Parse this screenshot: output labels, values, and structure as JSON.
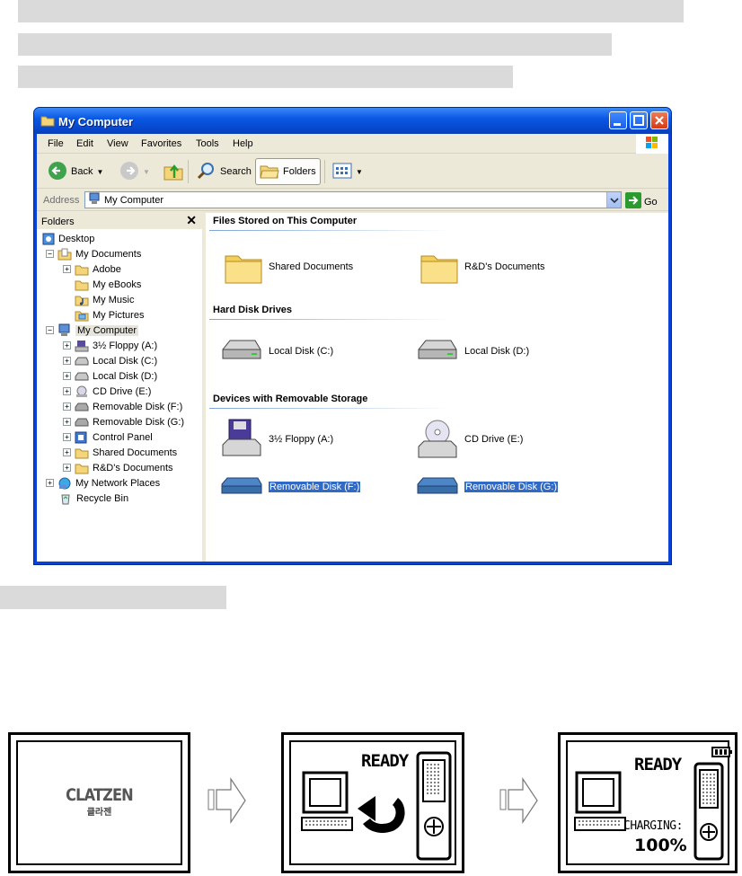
{
  "window": {
    "title": "My Computer",
    "menu": [
      "File",
      "Edit",
      "View",
      "Favorites",
      "Tools",
      "Help"
    ],
    "toolbar": {
      "back": "Back",
      "search": "Search",
      "folders": "Folders"
    },
    "address": {
      "label": "Address",
      "value": "My Computer",
      "go": "Go"
    }
  },
  "folders_pane": {
    "title": "Folders",
    "close": "✕",
    "tree": [
      {
        "label": "Desktop",
        "icon": "desktop-icon"
      },
      {
        "label": "My Documents",
        "icon": "my-documents-icon"
      },
      {
        "label": "Adobe",
        "icon": "folder-icon"
      },
      {
        "label": "My eBooks",
        "icon": "folder-icon"
      },
      {
        "label": "My Music",
        "icon": "music-folder-icon"
      },
      {
        "label": "My Pictures",
        "icon": "pictures-folder-icon"
      },
      {
        "label": "My Computer",
        "icon": "computer-icon"
      },
      {
        "label": "3½ Floppy (A:)",
        "icon": "floppy-icon"
      },
      {
        "label": "Local Disk (C:)",
        "icon": "disk-icon"
      },
      {
        "label": "Local Disk (D:)",
        "icon": "disk-icon"
      },
      {
        "label": "CD Drive (E:)",
        "icon": "cd-icon"
      },
      {
        "label": "Removable Disk (F:)",
        "icon": "removable-disk-icon"
      },
      {
        "label": "Removable Disk (G:)",
        "icon": "removable-disk-icon"
      },
      {
        "label": "Control Panel",
        "icon": "control-panel-icon"
      },
      {
        "label": "Shared Documents",
        "icon": "folder-icon"
      },
      {
        "label": "R&D's Documents",
        "icon": "folder-icon"
      },
      {
        "label": "My Network Places",
        "icon": "network-icon"
      },
      {
        "label": "Recycle Bin",
        "icon": "recycle-bin-icon"
      }
    ]
  },
  "content": {
    "groups": [
      {
        "title": "Files Stored on This Computer",
        "items": [
          "Shared Documents",
          "R&D's Documents"
        ]
      },
      {
        "title": "Hard Disk Drives",
        "items": [
          "Local Disk (C:)",
          "Local Disk (D:)"
        ]
      },
      {
        "title": "Devices with Removable Storage",
        "items": [
          "3½ Floppy (A:)",
          "CD Drive (E:)",
          "Removable Disk (F:)",
          "Removable Disk (G:)"
        ]
      }
    ]
  },
  "device_screens": {
    "screen1": {
      "logo": "CLATZEN",
      "logo_sub": "클라젠"
    },
    "screen2": {
      "status": "READY"
    },
    "screen3": {
      "status": "READY",
      "charging_label": "CHARGING:",
      "charging_value": "100%"
    }
  }
}
